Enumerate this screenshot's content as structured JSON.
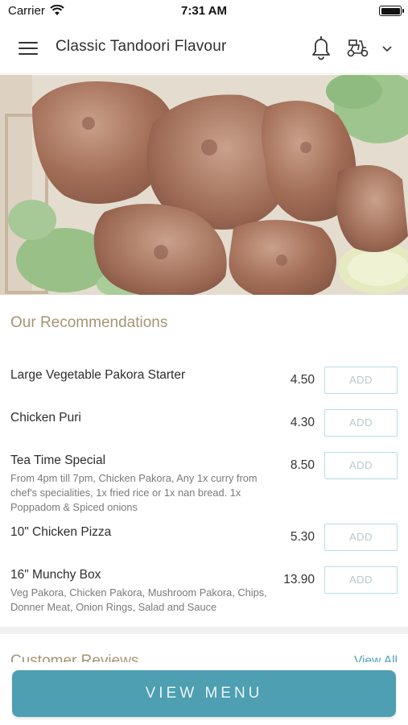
{
  "status_bar": {
    "carrier": "Carrier",
    "time": "7:31 AM"
  },
  "header": {
    "title": "Classic Tandoori Flavour",
    "icons": [
      "hamburger-menu-icon",
      "bell-icon",
      "scooter-icon",
      "chevron-down-icon"
    ]
  },
  "hero": {
    "image": "tandoori-chicken-photo"
  },
  "recommendations": {
    "title": "Our Recommendations",
    "add_label": "ADD",
    "items": [
      {
        "name": "Large Vegetable Pakora Starter",
        "price": "4.50",
        "description": ""
      },
      {
        "name": "Chicken Puri",
        "price": "4.30",
        "description": ""
      },
      {
        "name": "Tea Time Special",
        "price": "8.50",
        "description": "From 4pm till 7pm, Chicken Pakora, Any 1x curry from chef's specialities, 1x fried rice or 1x nan bread. 1x Poppadom & Spiced onions"
      },
      {
        "name": "10\" Chicken Pizza",
        "price": "5.30",
        "description": ""
      },
      {
        "name": "16\" Munchy Box",
        "price": "13.90",
        "description": "Veg Pakora, Chicken Pakora, Mushroom Pakora, Chips, Donner Meat, Onion Rings, Salad and Sauce"
      }
    ]
  },
  "reviews": {
    "title": "Customer Reviews",
    "view_all": "View All"
  },
  "footer": {
    "view_menu": "VIEW MENU"
  },
  "colors": {
    "accent": "#4d9fb1",
    "section_title": "#a89473",
    "add_border": "#b7dde5"
  }
}
